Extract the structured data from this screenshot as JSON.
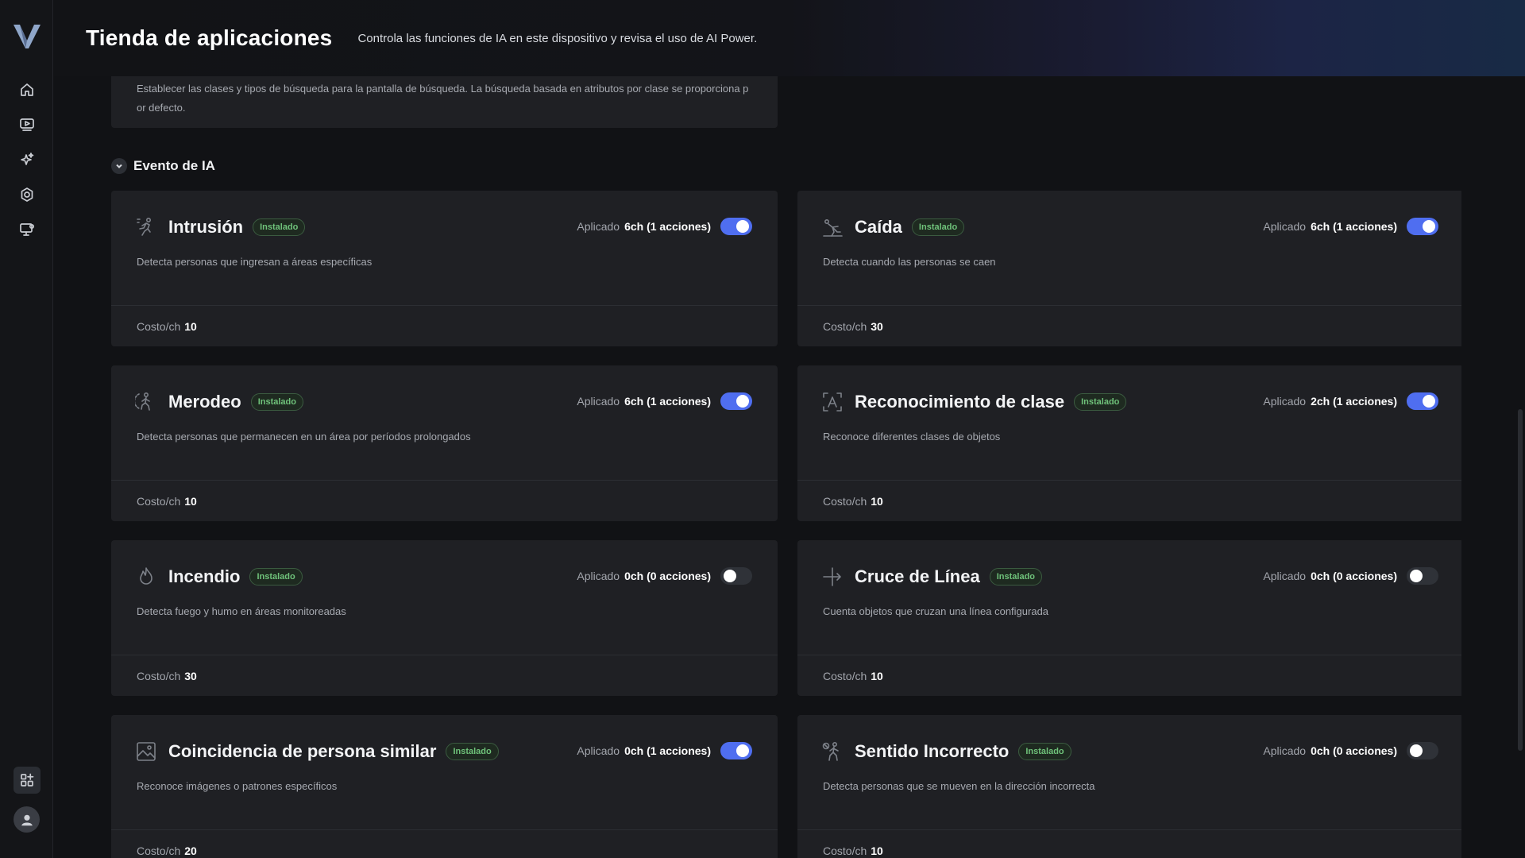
{
  "header": {
    "title": "Tienda de aplicaciones",
    "subtitle": "Controla las funciones de IA en este dispositivo y revisa el uso de AI Power."
  },
  "sidebar": {
    "items": [
      {
        "name": "home-icon"
      },
      {
        "name": "video-player-icon"
      },
      {
        "name": "ai-sparkle-icon"
      },
      {
        "name": "settings-gear-icon"
      },
      {
        "name": "monitor-settings-icon"
      }
    ],
    "bottom": [
      {
        "name": "app-store-icon"
      },
      {
        "name": "user-avatar-icon"
      }
    ]
  },
  "top_card": {
    "line1": "Establecer las clases y tipos de búsqueda para la pantalla de búsqueda. La búsqueda basada en atributos por clase se proporciona p",
    "line2": "or defecto."
  },
  "section": {
    "title": "Evento de IA"
  },
  "labels": {
    "applied": "Aplicado",
    "cost": "Costo/ch",
    "installed": "Instalado"
  },
  "cards": [
    {
      "title": "Intrusión",
      "icon": "intrusion-running-person-icon",
      "applied": "6ch (1 acciones)",
      "enabled": true,
      "description": "Detecta personas que ingresan a áreas específicas",
      "cost": "10"
    },
    {
      "title": "Caída",
      "icon": "fall-person-icon",
      "applied": "6ch (1 acciones)",
      "enabled": true,
      "description": "Detecta cuando las personas se caen",
      "cost": "30"
    },
    {
      "title": "Merodeo",
      "icon": "loitering-person-icon",
      "applied": "6ch (1 acciones)",
      "enabled": true,
      "description": "Detecta personas que permanecen en un área por períodos prolongados",
      "cost": "10"
    },
    {
      "title": "Reconocimiento de clase",
      "icon": "class-recognition-icon",
      "applied": "2ch (1 acciones)",
      "enabled": true,
      "description": "Reconoce diferentes clases de objetos",
      "cost": "10"
    },
    {
      "title": "Incendio",
      "icon": "fire-icon",
      "applied": "0ch (0 acciones)",
      "enabled": false,
      "description": "Detecta fuego y humo en áreas monitoreadas",
      "cost": "30"
    },
    {
      "title": "Cruce de Línea",
      "icon": "line-crossing-icon",
      "applied": "0ch (0 acciones)",
      "enabled": false,
      "description": "Cuenta objetos que cruzan una línea configurada",
      "cost": "10"
    },
    {
      "title": "Coincidencia de persona similar",
      "icon": "image-match-icon",
      "applied": "0ch (1 acciones)",
      "enabled": true,
      "description": "Reconoce imágenes o patrones específicos",
      "cost": "20"
    },
    {
      "title": "Sentido Incorrecto",
      "icon": "wrong-direction-icon",
      "applied": "0ch (0 acciones)",
      "enabled": false,
      "description": "Detecta personas que se mueven en la dirección incorrecta",
      "cost": "10"
    }
  ]
}
